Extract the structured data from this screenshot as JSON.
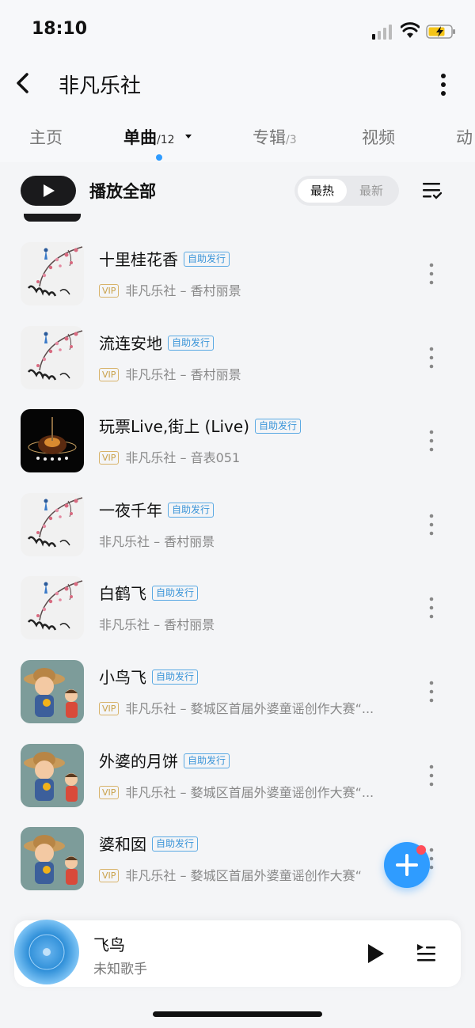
{
  "status": {
    "time": "18:10"
  },
  "header": {
    "title": "非凡乐社"
  },
  "tabs": [
    {
      "label": "主页",
      "count": ""
    },
    {
      "label": "单曲",
      "count": "/12"
    },
    {
      "label": "专辑",
      "count": "/3"
    },
    {
      "label": "视频",
      "count": ""
    },
    {
      "label": "动",
      "count": ""
    }
  ],
  "toolbar": {
    "play_all": "播放全部",
    "sort_hot": "最热",
    "sort_new": "最新"
  },
  "songs": [
    {
      "title": "十里桂花香",
      "badge": "自助发行",
      "vip": "VIP",
      "subtitle": "非凡乐社 – 香村丽景",
      "cover": "plum-blossom-cover"
    },
    {
      "title": "流连安地",
      "badge": "自助发行",
      "vip": "VIP",
      "subtitle": "非凡乐社 – 香村丽景",
      "cover": "plum-blossom-cover"
    },
    {
      "title": "玩票Live,街上 (Live)",
      "badge": "自助发行",
      "vip": "VIP",
      "subtitle": "非凡乐社 – 音表051",
      "cover": "guitar-cover"
    },
    {
      "title": "一夜千年",
      "badge": "自助发行",
      "vip": "",
      "subtitle": "非凡乐社 – 香村丽景",
      "cover": "plum-blossom-cover"
    },
    {
      "title": "白鹤飞",
      "badge": "自助发行",
      "vip": "",
      "subtitle": "非凡乐社 – 香村丽景",
      "cover": "plum-blossom-cover"
    },
    {
      "title": "小鸟飞",
      "badge": "自助发行",
      "vip": "VIP",
      "subtitle": "非凡乐社 – 婺城区首届外婆童谣创作大赛“...",
      "cover": "cartoon-kids-cover"
    },
    {
      "title": "外婆的月饼",
      "badge": "自助发行",
      "vip": "VIP",
      "subtitle": "非凡乐社 – 婺城区首届外婆童谣创作大赛“...",
      "cover": "cartoon-kids-cover"
    },
    {
      "title": "婆和囡",
      "badge": "自助发行",
      "vip": "VIP",
      "subtitle": "非凡乐社 – 婺城区首届外婆童谣创作大赛“",
      "cover": "cartoon-kids-cover"
    }
  ],
  "player": {
    "title": "飞鸟",
    "artist": "未知歌手"
  },
  "colors": {
    "accent": "#2f9cff",
    "badge": "#3a94d8",
    "vip": "#c9a14a",
    "notify": "#ff4d5a"
  }
}
